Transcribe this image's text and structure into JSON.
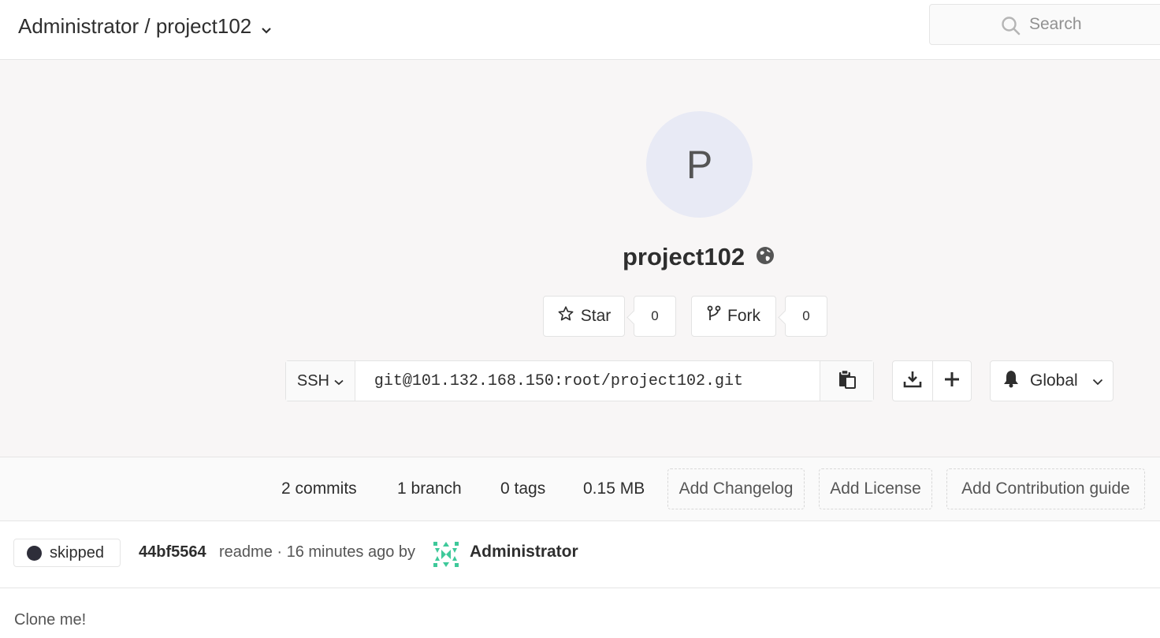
{
  "header": {
    "breadcrumb": "Administrator / project102",
    "search_placeholder": "Search"
  },
  "project": {
    "avatar_letter": "P",
    "name": "project102",
    "star_label": "Star",
    "star_count": "0",
    "fork_label": "Fork",
    "fork_count": "0"
  },
  "clone": {
    "protocol": "SSH",
    "url": "git@101.132.168.150:root/project102.git"
  },
  "notifications": {
    "level": "Global"
  },
  "stats": {
    "commits": "2 commits",
    "branches": "1 branch",
    "tags": "0 tags",
    "size": "0.15 MB",
    "add_changelog": "Add Changelog",
    "add_license": "Add License",
    "add_contribution": "Add Contribution guide"
  },
  "commit": {
    "status": "skipped",
    "sha": "44bf5564",
    "message": "readme · 16 minutes ago by",
    "author": "Administrator"
  },
  "readme": {
    "text": "Clone me!"
  },
  "colors": {
    "hero_bg": "#f8f6f6",
    "avatar_bg": "#e8eaf5",
    "author_avatar": "#3ec99a"
  },
  "icons": [
    "chevron-down-icon",
    "search-icon",
    "globe-icon",
    "star-icon",
    "fork-icon",
    "copy-icon",
    "download-icon",
    "plus-icon",
    "bell-icon",
    "status-dot-icon"
  ]
}
